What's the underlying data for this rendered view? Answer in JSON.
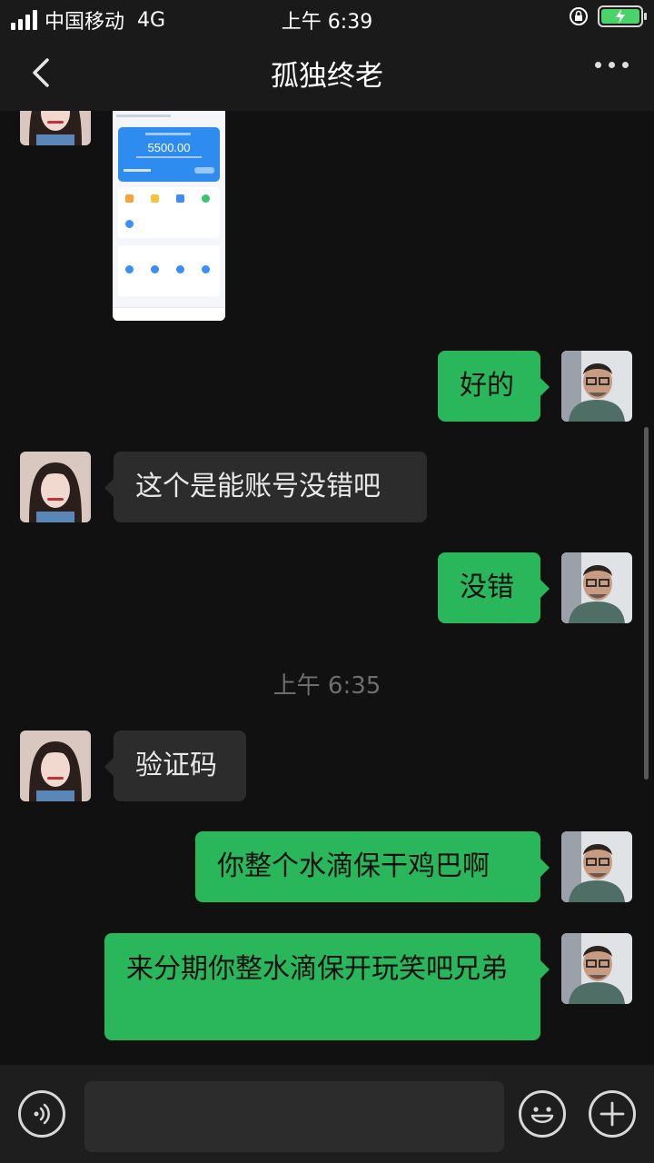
{
  "status_bar": {
    "carrier": "中国移动",
    "network": "4G",
    "time": "上午 6:39"
  },
  "header": {
    "title": "孤独终老"
  },
  "screenshot_thumb": {
    "amount": "5500.00"
  },
  "messages": [
    {
      "side": "out",
      "text": "好的"
    },
    {
      "side": "in",
      "text": "这个是能账号没错吧"
    },
    {
      "side": "out",
      "text": "没错"
    },
    {
      "side": "in",
      "text": "验证码"
    },
    {
      "side": "out",
      "text": "你整个水滴保干鸡巴啊"
    },
    {
      "side": "out",
      "text": "来分期你整水滴保开玩笑吧兄弟"
    }
  ],
  "timestamp": "上午 6:35",
  "input": {
    "value": ""
  },
  "colors": {
    "background": "#111111",
    "bubble_out": "#2ab75c",
    "bubble_in": "#2c2c2c",
    "battery": "#4ad36a"
  },
  "icons": {
    "back": "chevron-left-icon",
    "more": "more-dots-icon",
    "voice": "voice-icon",
    "emoji": "emoji-icon",
    "plus": "plus-icon"
  }
}
